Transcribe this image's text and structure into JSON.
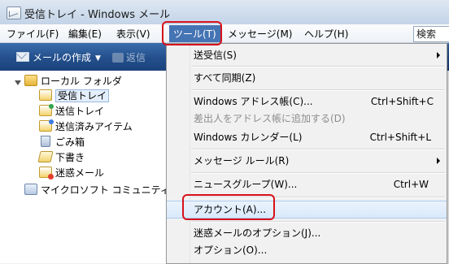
{
  "window": {
    "title": "受信トレイ - Windows メール"
  },
  "menubar": {
    "file": "ファイル(F)",
    "edit": "編集(E)",
    "view": "表示(V)",
    "tools": "ツール(T)",
    "message": "メッセージ(M)",
    "help": "ヘルプ(H)",
    "search": "検索"
  },
  "toolbar": {
    "new_mail": "メールの作成",
    "reply": "返信"
  },
  "folders": {
    "root": "ローカル フォルダ",
    "inbox": "受信トレイ",
    "outbox": "送信トレイ",
    "sent": "送信済みアイテム",
    "trash": "ごみ箱",
    "drafts": "下書き",
    "junk": "迷惑メール",
    "community": "マイクロソフト コミュニティ"
  },
  "tools_menu": {
    "send_receive": "送受信(S)",
    "sync_all": "すべて同期(Z)",
    "address_book": "Windows アドレス帳(C)...",
    "address_book_shortcut": "Ctrl+Shift+C",
    "add_sender": "差出人をアドレス帳に追加する(D)",
    "calendar": "Windows カレンダー(L)",
    "calendar_shortcut": "Ctrl+Shift+L",
    "message_rules": "メッセージ ルール(R)",
    "newsgroups": "ニュースグループ(W)...",
    "newsgroups_shortcut": "Ctrl+W",
    "accounts": "アカウント(A)...",
    "junk_options": "迷惑メールのオプション(J)...",
    "options": "オプション(O)..."
  },
  "colors": {
    "highlight_box": "#d8121b",
    "toolbar_blue": "#234f8c"
  }
}
